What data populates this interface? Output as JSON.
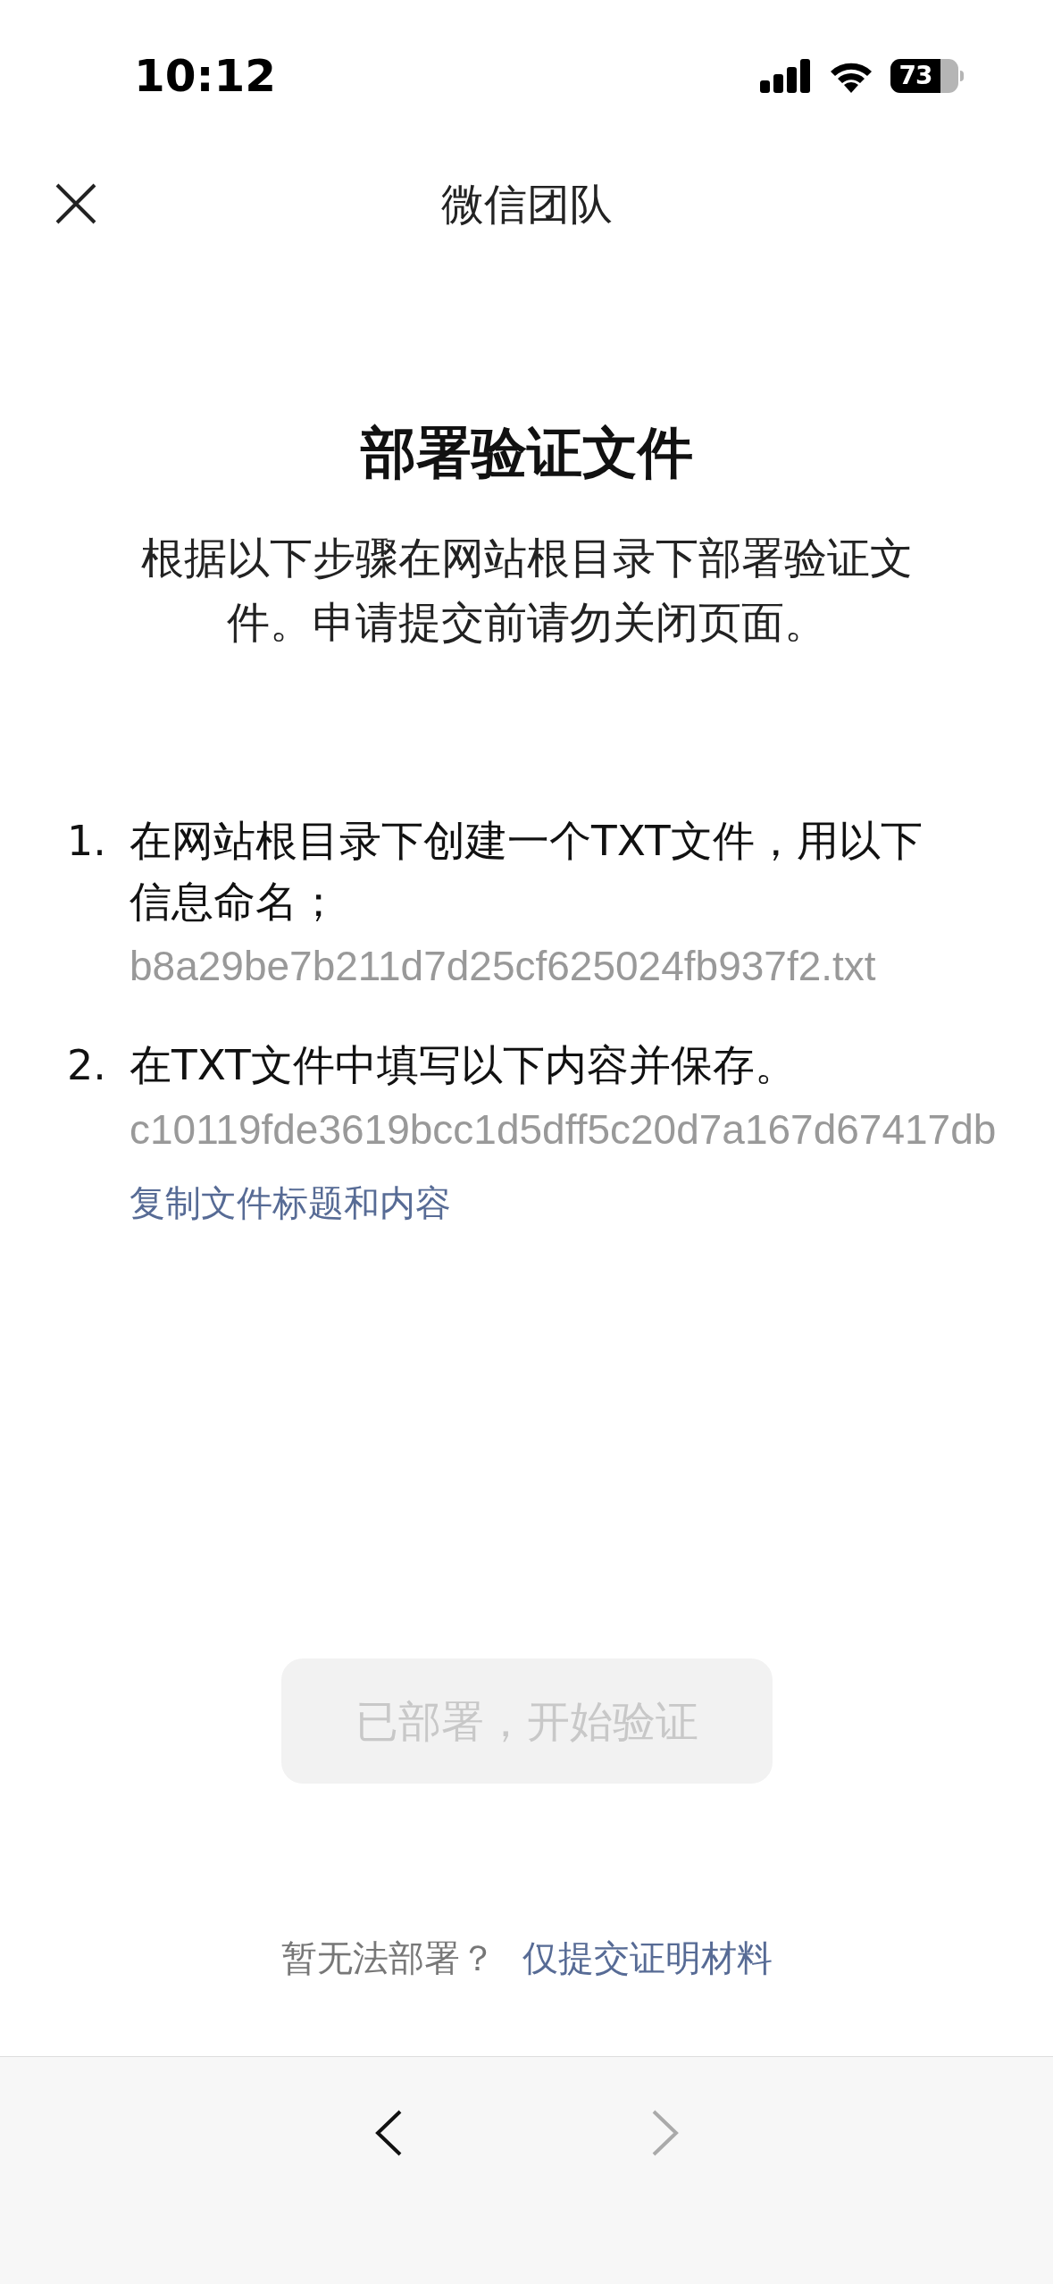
{
  "status_bar": {
    "time": "10:12",
    "battery": "73"
  },
  "nav": {
    "title": "微信团队"
  },
  "heading": "部署验证文件",
  "intro": "根据以下步骤在网站根目录下部署验证文件。申请提交前请勿关闭页面。",
  "steps": [
    {
      "number": "1.",
      "text": "在网站根目录下创建一个TXT文件，用以下信息命名；",
      "value": "b8a29be7b211d7d25cf625024fb937f2.txt"
    },
    {
      "number": "2.",
      "text": "在TXT文件中填写以下内容并保存。",
      "value": "c10119fde3619bcc1d5dff5c20d7a167d67417db"
    }
  ],
  "copy_link": "复制文件标题和内容",
  "primary_button": {
    "label": "已部署，开始验证",
    "disabled": true
  },
  "footer": {
    "question": "暂无法部署？",
    "link": "仅提交证明材料"
  },
  "toolbar": {
    "back_disabled": false,
    "forward_disabled": true
  }
}
